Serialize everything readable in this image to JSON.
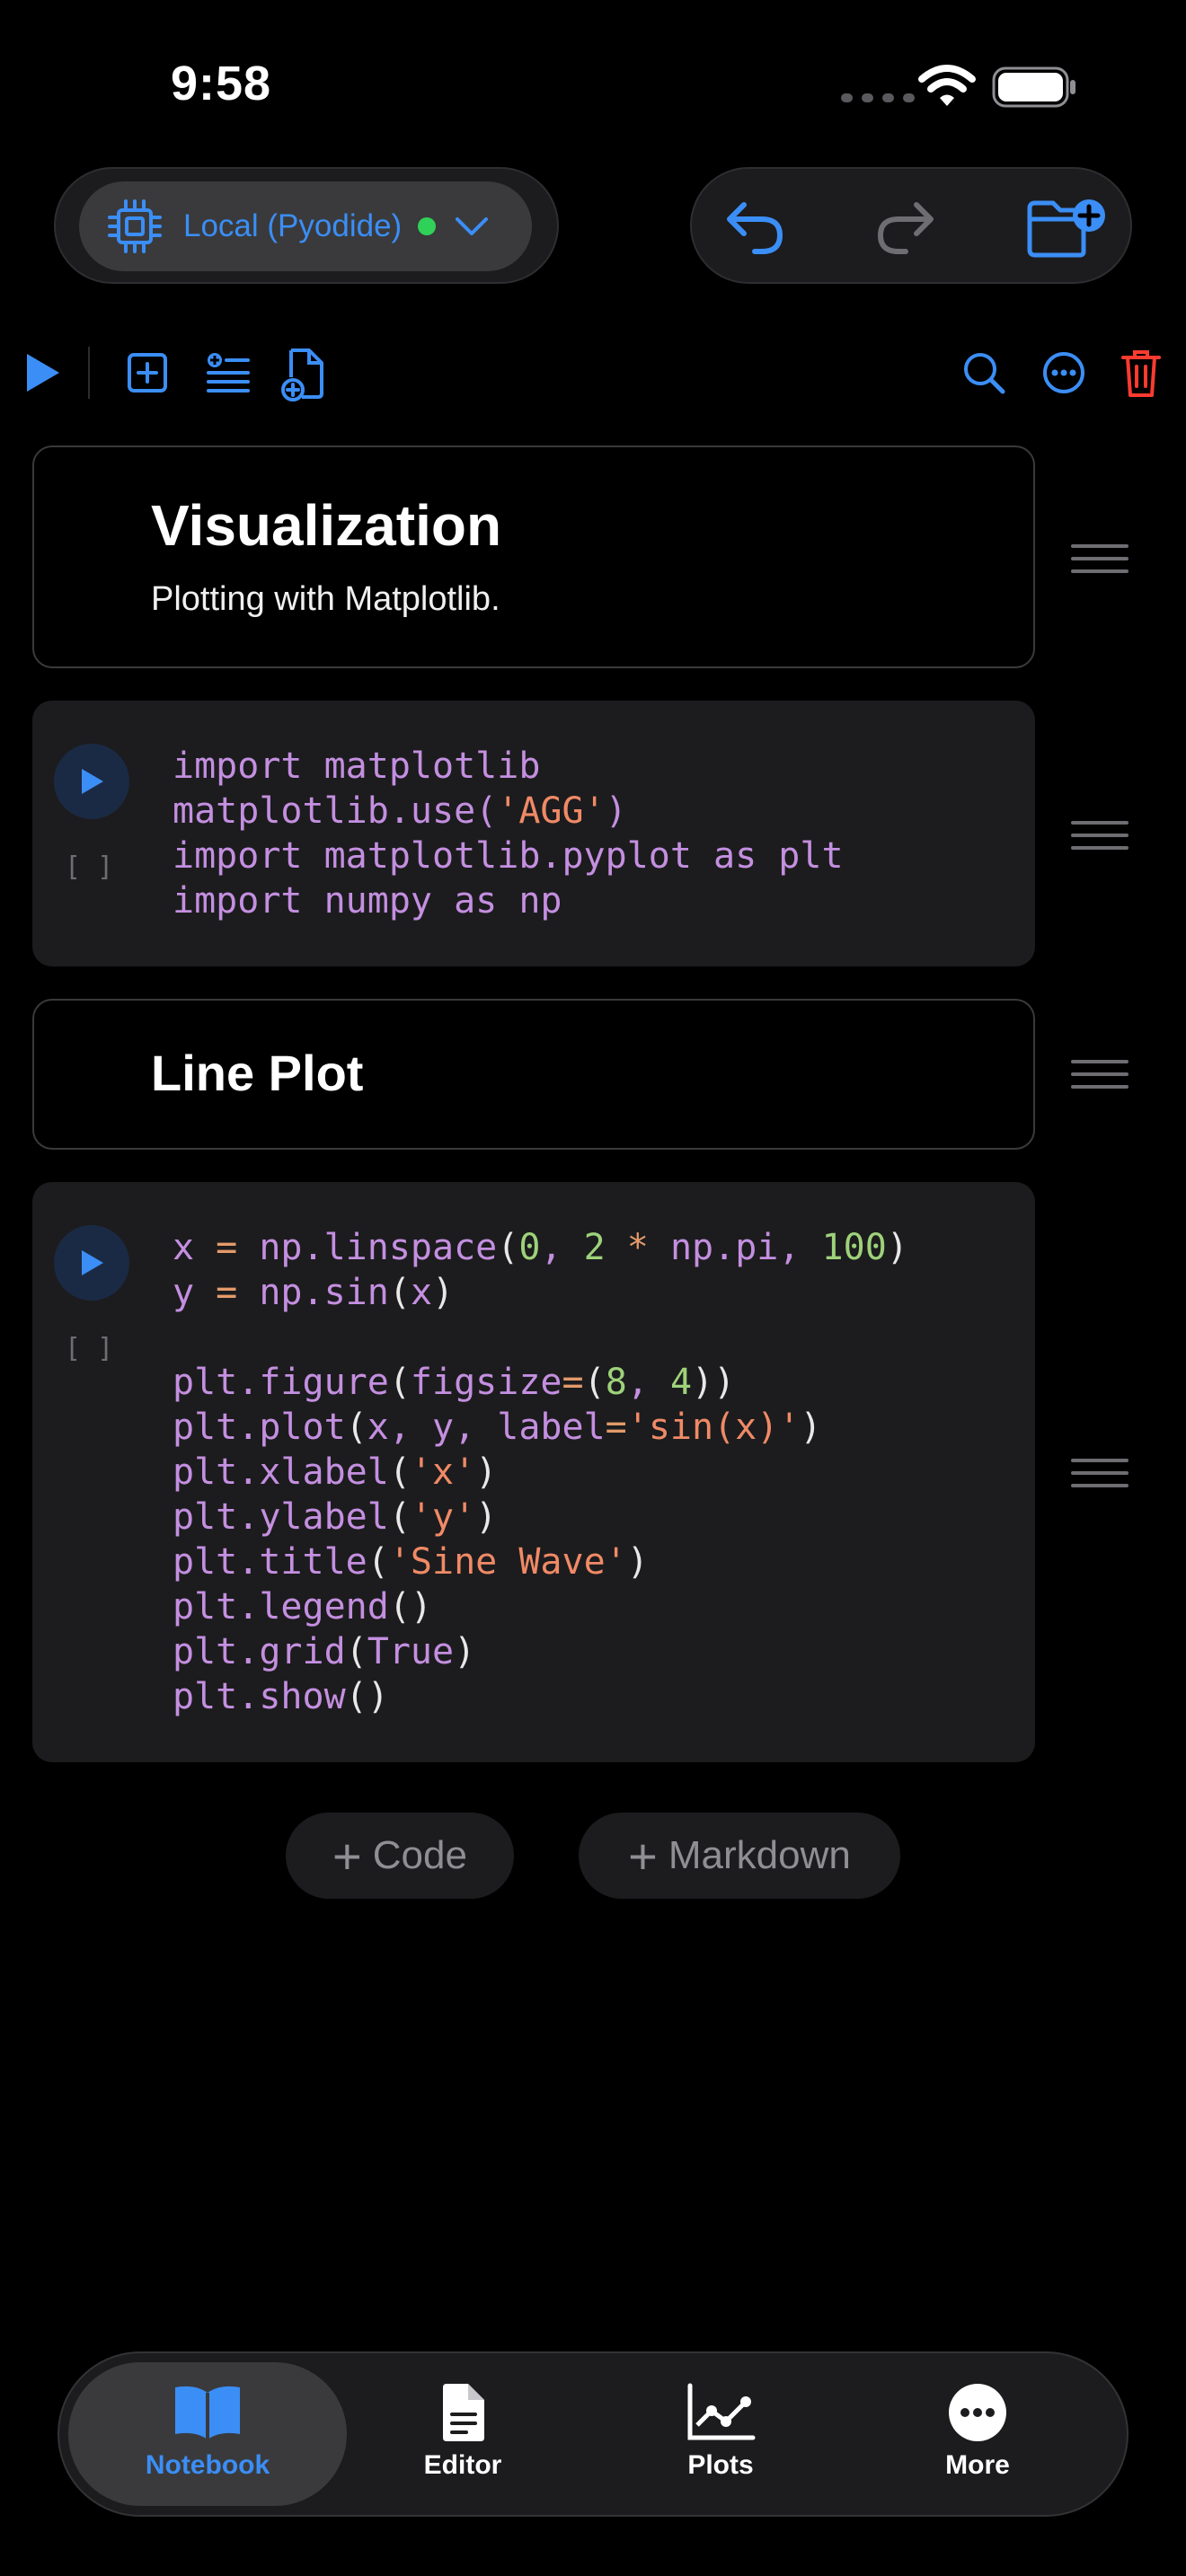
{
  "status_bar": {
    "time": "9:58"
  },
  "kernel": {
    "label": "Local (Pyodide)"
  },
  "cells": [
    {
      "type": "markdown",
      "heading": "Visualization",
      "text": "Plotting with Matplotlib."
    },
    {
      "type": "code",
      "exec": "[ ]",
      "lines": [
        "import matplotlib",
        "matplotlib.use('AGG')",
        "import matplotlib.pyplot as plt",
        "import numpy as np"
      ]
    },
    {
      "type": "markdown",
      "heading": "Line Plot"
    },
    {
      "type": "code",
      "exec": "[ ]",
      "lines": [
        "x = np.linspace(0, 2 * np.pi, 100)",
        "y = np.sin(x)",
        "",
        "plt.figure(figsize=(8, 4))",
        "plt.plot(x, y, label='sin(x)')",
        "plt.xlabel('x')",
        "plt.ylabel('y')",
        "plt.title('Sine Wave')",
        "plt.legend()",
        "plt.grid(True)",
        "plt.show()"
      ]
    }
  ],
  "add_buttons": {
    "code": "Code",
    "markdown": "Markdown"
  },
  "tabs": [
    {
      "label": "Notebook",
      "icon": "book-icon",
      "active": true
    },
    {
      "label": "Editor",
      "icon": "document-icon"
    },
    {
      "label": "Plots",
      "icon": "chart-icon"
    },
    {
      "label": "More",
      "icon": "ellipsis-icon"
    }
  ],
  "colors": {
    "accent": "#3b8ef5",
    "danger": "#ff3b30",
    "status_ok": "#30d158",
    "code_keyword": "#c48fe0",
    "code_string": "#f08a66",
    "code_number": "#9ed27a"
  }
}
